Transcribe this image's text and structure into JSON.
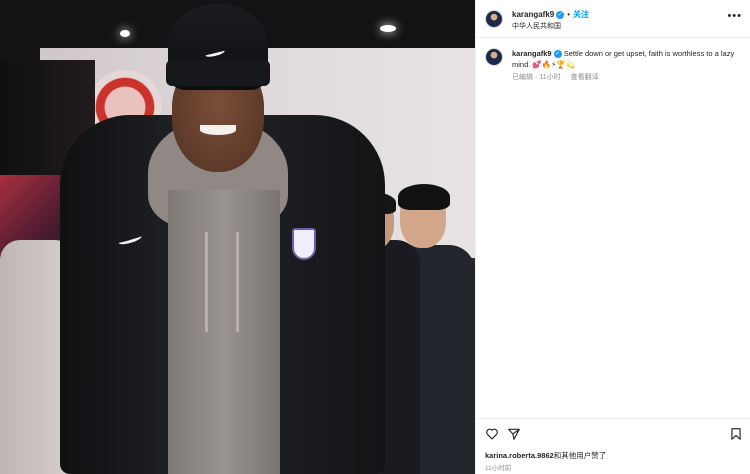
{
  "post": {
    "username": "karangafk9",
    "follow_label": "关注",
    "location": "中华人民共和国",
    "more_icon": "more-horizontal-icon"
  },
  "caption": {
    "username": "karangafk9",
    "text": "Settle down or get upset, faith is worthless to a lazy mind. 💕🔥⚡🏆💫",
    "edited_label": "已编辑",
    "time": "11小时",
    "translate_label": "查看翻译"
  },
  "actions": {
    "like_icon": "heart-icon",
    "share_icon": "send-icon",
    "save_icon": "bookmark-icon"
  },
  "likes": {
    "liker": "karina.roberta.9862",
    "suffix": "和其他用户赞了"
  },
  "timestamp": "11小时前",
  "colors": {
    "accent": "#0095f6",
    "verified": "#1d9bf0",
    "muted": "#8e8e8e"
  }
}
